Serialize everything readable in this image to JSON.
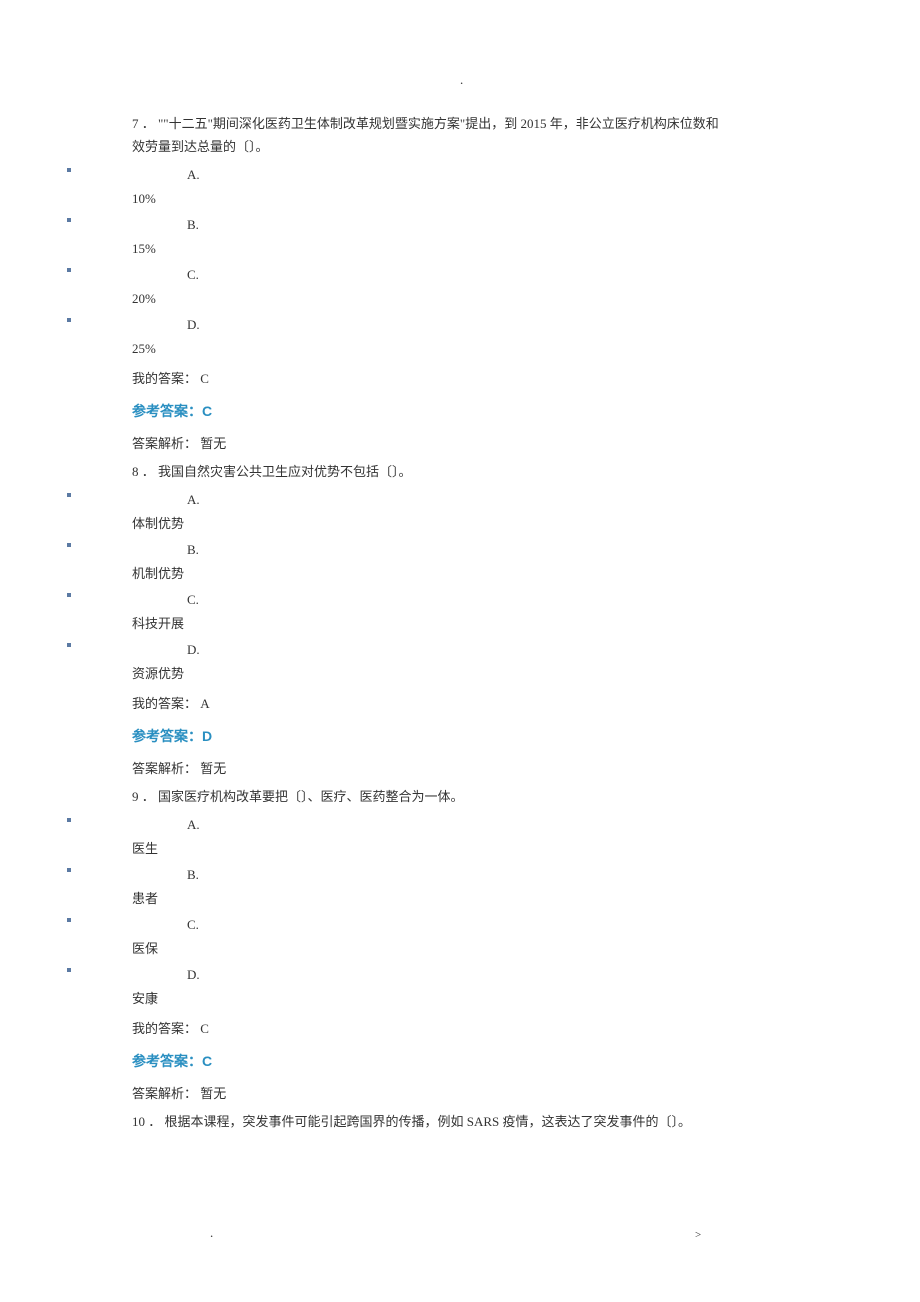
{
  "page_marker_top": ".",
  "footer_left": ".",
  "footer_right": ">",
  "questions": [
    {
      "number": "7 ．",
      "text_lines": [
        "7 ． \"\"十二五\"期间深化医药卫生体制改革规划暨实施方案\"提出，到 2015 年，非公立医疗机构床位数和",
        "效劳量到达总量的〔〕。"
      ],
      "options": [
        {
          "letter": "A.",
          "text": "10%"
        },
        {
          "letter": "B.",
          "text": "15%"
        },
        {
          "letter": "C.",
          "text": "20%"
        },
        {
          "letter": "D.",
          "text": "25%"
        }
      ],
      "my_answer": "我的答案： C",
      "ref_answer": "参考答案：C",
      "explain": "答案解析： 暂无"
    },
    {
      "number": "8 ．",
      "text_lines": [
        "8 ． 我国自然灾害公共卫生应对优势不包括〔〕。"
      ],
      "options": [
        {
          "letter": "A.",
          "text": "体制优势"
        },
        {
          "letter": "B.",
          "text": "机制优势"
        },
        {
          "letter": "C.",
          "text": "科技开展"
        },
        {
          "letter": "D.",
          "text": "资源优势"
        }
      ],
      "my_answer": "我的答案： A",
      "ref_answer": "参考答案：D",
      "explain": "答案解析： 暂无"
    },
    {
      "number": "9 ．",
      "text_lines": [
        "9 ． 国家医疗机构改革要把〔〕、医疗、医药整合为一体。"
      ],
      "options": [
        {
          "letter": "A.",
          "text": "医生"
        },
        {
          "letter": "B.",
          "text": "患者"
        },
        {
          "letter": "C.",
          "text": "医保"
        },
        {
          "letter": "D.",
          "text": "安康"
        }
      ],
      "my_answer": "我的答案： C",
      "ref_answer": "参考答案：C",
      "explain": "答案解析： 暂无"
    },
    {
      "number": "10 ．",
      "text_lines": [
        "10 ． 根据本课程，突发事件可能引起跨国界的传播，例如 SARS 疫情，这表达了突发事件的〔〕。"
      ],
      "options": [],
      "my_answer": "",
      "ref_answer": "",
      "explain": ""
    }
  ]
}
